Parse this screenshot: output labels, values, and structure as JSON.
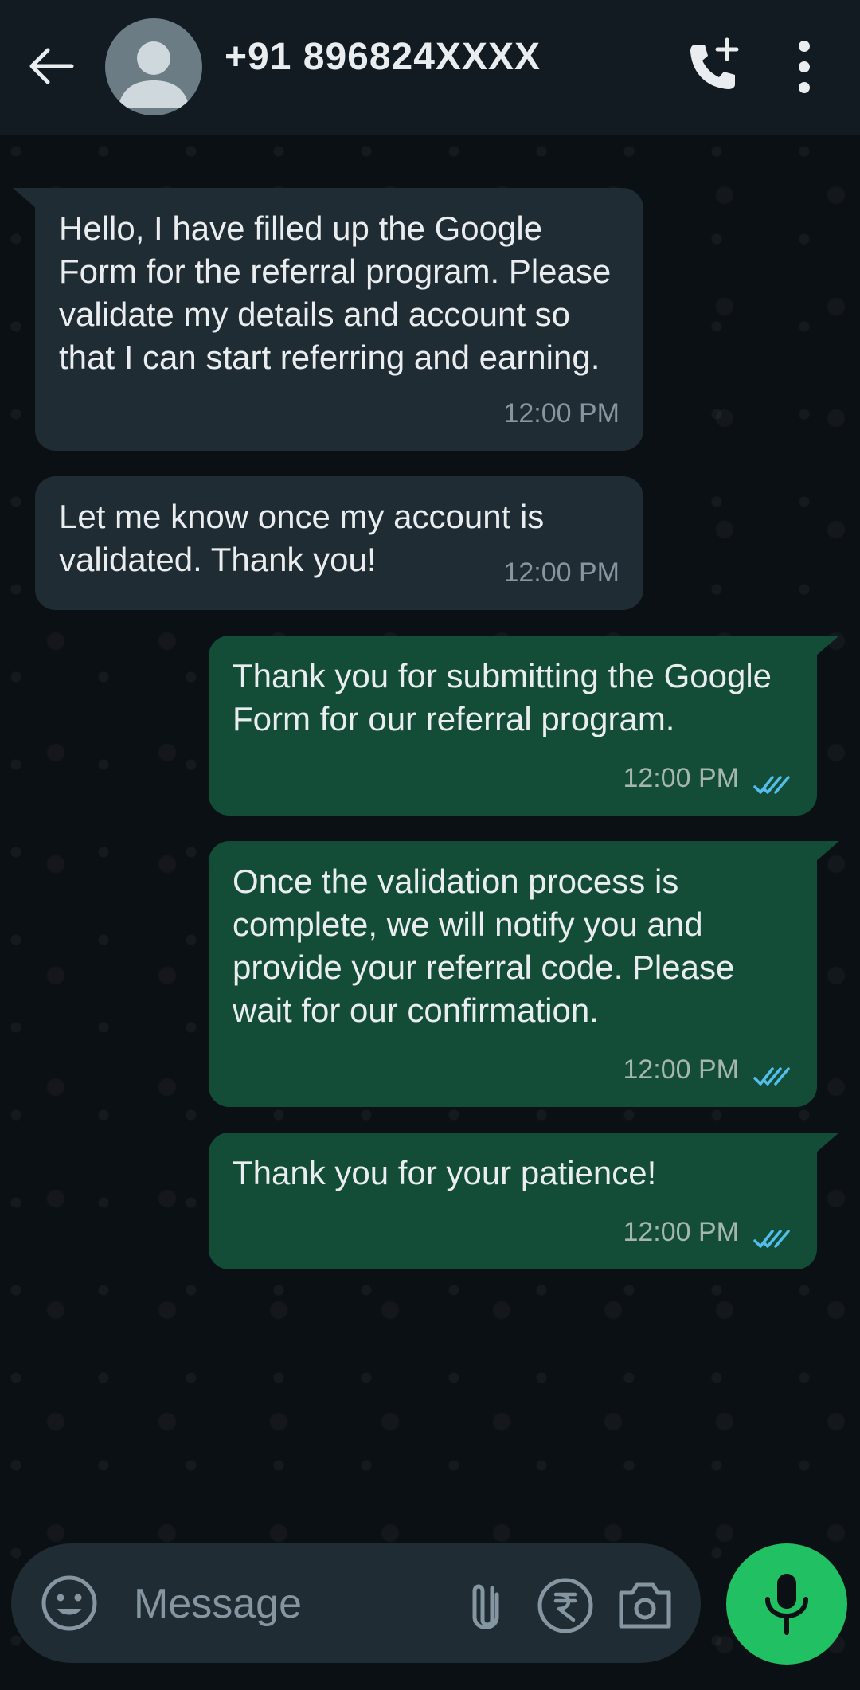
{
  "header": {
    "contact_name": "+91 896824XXXX"
  },
  "messages": [
    {
      "direction": "in",
      "text": "Hello, I have filled up the Google Form for the referral program. Please validate my details and account so that I can start referring and earning.",
      "time": "12:00 PM"
    },
    {
      "direction": "in",
      "text": "Let me know once my account is validated. Thank you!",
      "time": "12:00 PM"
    },
    {
      "direction": "out",
      "text": "Thank you for submitting the Google Form for our referral program.",
      "time": "12:00 PM",
      "status": "read"
    },
    {
      "direction": "out",
      "text": "Once the validation process is complete, we will notify you and provide your referral code. Please wait for our confirmation.",
      "time": "12:00 PM",
      "status": "read"
    },
    {
      "direction": "out",
      "text": "Thank you for your patience!",
      "time": "12:00 PM",
      "status": "read"
    }
  ],
  "composer": {
    "placeholder": "Message"
  },
  "colors": {
    "incoming_bubble": "#202c33",
    "outgoing_bubble": "#144d37",
    "read_ticks": "#53bdeb",
    "mic_button": "#21c063"
  },
  "icons": [
    "back-arrow-icon",
    "avatar-icon",
    "add-call-icon",
    "more-options-icon",
    "emoji-icon",
    "attach-icon",
    "rupee-payment-icon",
    "camera-icon",
    "mic-icon",
    "double-tick-icon"
  ]
}
